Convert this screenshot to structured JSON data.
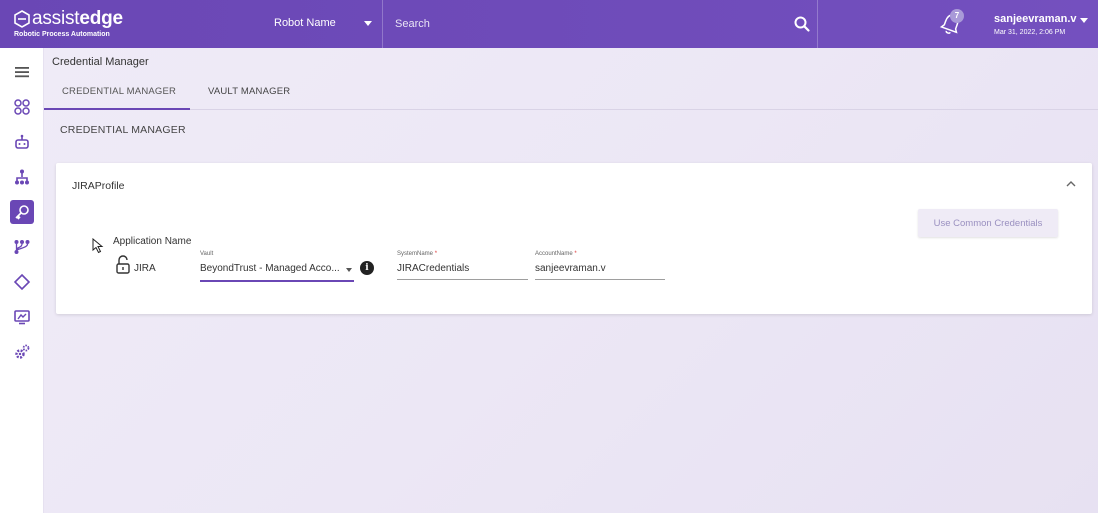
{
  "header": {
    "logo_text_a": "assist",
    "logo_text_b": "edge",
    "logo_subtitle": "Robotic Process Automation",
    "robot_select_label": "Robot Name",
    "search_placeholder": "Search",
    "notification_count": "7",
    "user_name": "sanjeevraman.v",
    "datetime": "Mar 31, 2022, 2:06 PM"
  },
  "sidebar": {
    "items": [
      {
        "icon": "menu-icon"
      },
      {
        "icon": "dashboard-icon"
      },
      {
        "icon": "robot-icon"
      },
      {
        "icon": "hierarchy-icon"
      },
      {
        "icon": "key-icon",
        "active": true
      },
      {
        "icon": "workflow-icon"
      },
      {
        "icon": "diamond-icon"
      },
      {
        "icon": "monitor-icon"
      },
      {
        "icon": "settings-icon"
      }
    ]
  },
  "page": {
    "title": "Credential Manager",
    "tabs": [
      {
        "label": "CREDENTIAL MANAGER",
        "active": true
      },
      {
        "label": "VAULT MANAGER",
        "active": false
      }
    ],
    "section_title": "CREDENTIAL MANAGER"
  },
  "profile_card": {
    "title": "JIRAProfile",
    "common_credentials_button": "Use Common Credentials",
    "application_name_label": "Application Name",
    "application_name": "JIRA",
    "vault": {
      "label": "Vault",
      "value": "BeyondTrust - Managed Acco..."
    },
    "system_name": {
      "label": "SystemName",
      "required_mark": "*",
      "value": "JIRACredentials"
    },
    "account_name": {
      "label": "AccountName",
      "required_mark": "*",
      "value": "sanjeevraman.v"
    },
    "info_glyph": "i"
  },
  "colors": {
    "brand": "#6a47b5",
    "background": "#ece7f5",
    "card": "#ffffff"
  }
}
